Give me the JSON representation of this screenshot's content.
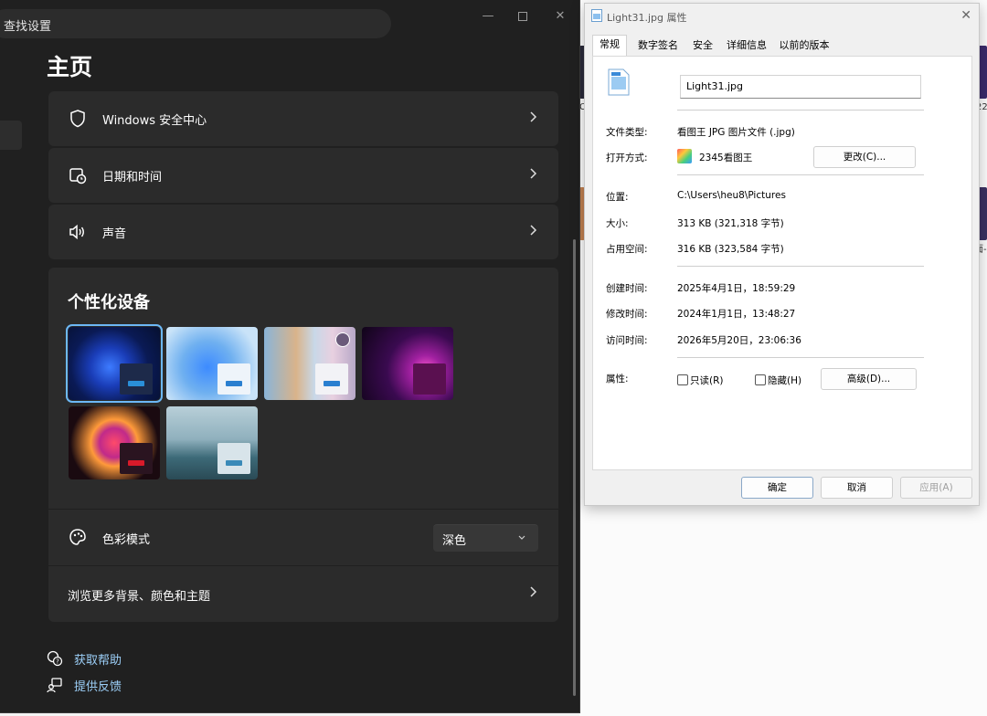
{
  "settings": {
    "search_placeholder": "查找设置",
    "page_title": "主页",
    "cards": [
      {
        "label": "Windows 安全中心",
        "icon": "shield-icon"
      },
      {
        "label": "日期和时间",
        "icon": "calendar-clock-icon"
      },
      {
        "label": "声音",
        "icon": "speaker-icon"
      }
    ],
    "personalization": {
      "title": "个性化设备",
      "color_mode_label": "色彩模式",
      "color_mode_value": "深色",
      "browse_label": "浏览更多背景、颜色和主题"
    },
    "links": {
      "help": "获取帮助",
      "feedback": "提供反馈"
    },
    "accent": "#6cb8f6"
  },
  "dialog": {
    "title": "Light31.jpg 属性",
    "tabs": [
      "常规",
      "数字签名",
      "安全",
      "详细信息",
      "以前的版本"
    ],
    "filename": "Light31.jpg",
    "rows": {
      "file_type_label": "文件类型:",
      "file_type_value": "看图王 JPG 图片文件 (.jpg)",
      "open_with_label": "打开方式:",
      "open_with_value": "2345看图王",
      "change_button": "更改(C)...",
      "location_label": "位置:",
      "location_value": "C:\\Users\\heu8\\Pictures",
      "size_label": "大小:",
      "size_value": "313 KB (321,318 字节)",
      "disk_size_label": "占用空间:",
      "disk_size_value": "316 KB (323,584 字节)",
      "created_label": "创建时间:",
      "created_value": "2025年4月1日，18:59:29",
      "modified_label": "修改时间:",
      "modified_value": "2024年1月1日，13:48:27",
      "accessed_label": "访问时间:",
      "accessed_value": "2026年5月20日，23:06:36",
      "attributes_label": "属性:",
      "readonly_label": "只读(R)",
      "hidden_label": "隐藏(H)",
      "advanced_button": "高级(D)..."
    },
    "buttons": {
      "ok": "确定",
      "cancel": "取消",
      "apply": "应用(A)"
    }
  },
  "background": {
    "fragments": [
      "C",
      "22",
      "面-"
    ]
  }
}
